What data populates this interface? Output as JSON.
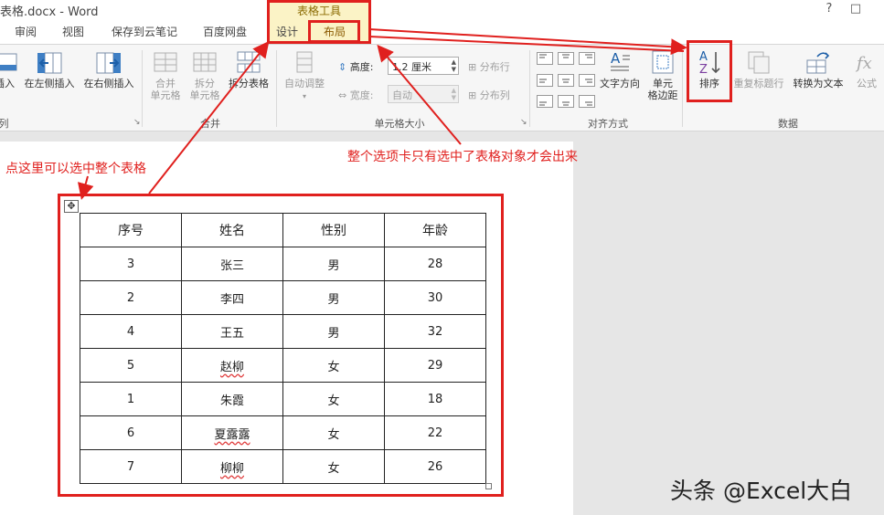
{
  "window": {
    "title": "表格.docx - Word",
    "help_label": "?",
    "restore_label": "□"
  },
  "tabs": {
    "review": "审阅",
    "view": "视图",
    "save_cloud": "保存到云笔记",
    "baidu": "百度网盘",
    "context_group": "表格工具",
    "design": "设计",
    "layout": "布局"
  },
  "ribbon": {
    "rows_cols": {
      "insert_below": "插入",
      "insert_left": "在左侧插入",
      "insert_right": "在右侧插入",
      "group_label": "列"
    },
    "merge": {
      "merge_cells_1": "合并",
      "merge_cells_2": "单元格",
      "split_cells_1": "拆分",
      "split_cells_2": "单元格",
      "split_table": "拆分表格",
      "group_label": "合并"
    },
    "cell_size": {
      "autofit": "自动调整",
      "height_label": "高度:",
      "height_value": "1.2 厘米",
      "width_label": "宽度:",
      "width_value": "自动",
      "distribute_rows": "分布行",
      "distribute_cols": "分布列",
      "group_label": "单元格大小"
    },
    "alignment": {
      "text_direction": "文字方向",
      "cell_margins_1": "单元",
      "cell_margins_2": "格边距",
      "group_label": "对齐方式"
    },
    "data": {
      "sort": "排序",
      "repeat_header": "重复标题行",
      "convert_text": "转换为文本",
      "formula": "公式",
      "group_label": "数据"
    }
  },
  "table": {
    "headers": [
      "序号",
      "姓名",
      "性别",
      "年龄"
    ],
    "rows": [
      [
        "3",
        "张三",
        "男",
        "28"
      ],
      [
        "2",
        "李四",
        "男",
        "30"
      ],
      [
        "4",
        "王五",
        "男",
        "32"
      ],
      [
        "5",
        "赵柳",
        "女",
        "29"
      ],
      [
        "1",
        "朱霞",
        "女",
        "18"
      ],
      [
        "6",
        "夏露露",
        "女",
        "22"
      ],
      [
        "7",
        "柳柳",
        "女",
        "26"
      ]
    ],
    "move_handle_glyph": "✥"
  },
  "annotations": {
    "select_table": "点这里可以选中整个表格",
    "tab_note": "整个选项卡只有选中了表格对象才会出来",
    "accent_color": "#e0201e"
  },
  "watermark": "头条 @Excel大白"
}
